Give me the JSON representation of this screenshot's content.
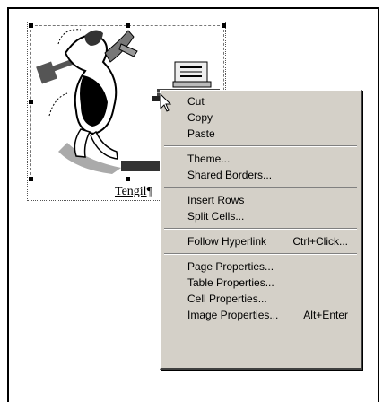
{
  "caption": {
    "text": "Tengil",
    "pilcrow": "¶"
  },
  "context_menu": {
    "groups": [
      [
        {
          "label": "Cut",
          "shortcut": ""
        },
        {
          "label": "Copy",
          "shortcut": ""
        },
        {
          "label": "Paste",
          "shortcut": ""
        }
      ],
      [
        {
          "label": "Theme...",
          "shortcut": ""
        },
        {
          "label": "Shared Borders...",
          "shortcut": ""
        }
      ],
      [
        {
          "label": "Insert Rows",
          "shortcut": ""
        },
        {
          "label": "Split Cells...",
          "shortcut": ""
        }
      ],
      [
        {
          "label": "Follow Hyperlink",
          "shortcut": "Ctrl+Click..."
        }
      ],
      [
        {
          "label": "Page Properties...",
          "shortcut": ""
        },
        {
          "label": "Table Properties...",
          "shortcut": ""
        },
        {
          "label": "Cell Properties...",
          "shortcut": ""
        },
        {
          "label": "Image Properties...",
          "shortcut": "Alt+Enter"
        }
      ]
    ]
  },
  "icons": {
    "cursor": "arrow-cursor-icon",
    "image": "clipart-figure-image"
  },
  "colors": {
    "menu_bg": "#d4d0c8",
    "menu_shadow": "#404040"
  }
}
